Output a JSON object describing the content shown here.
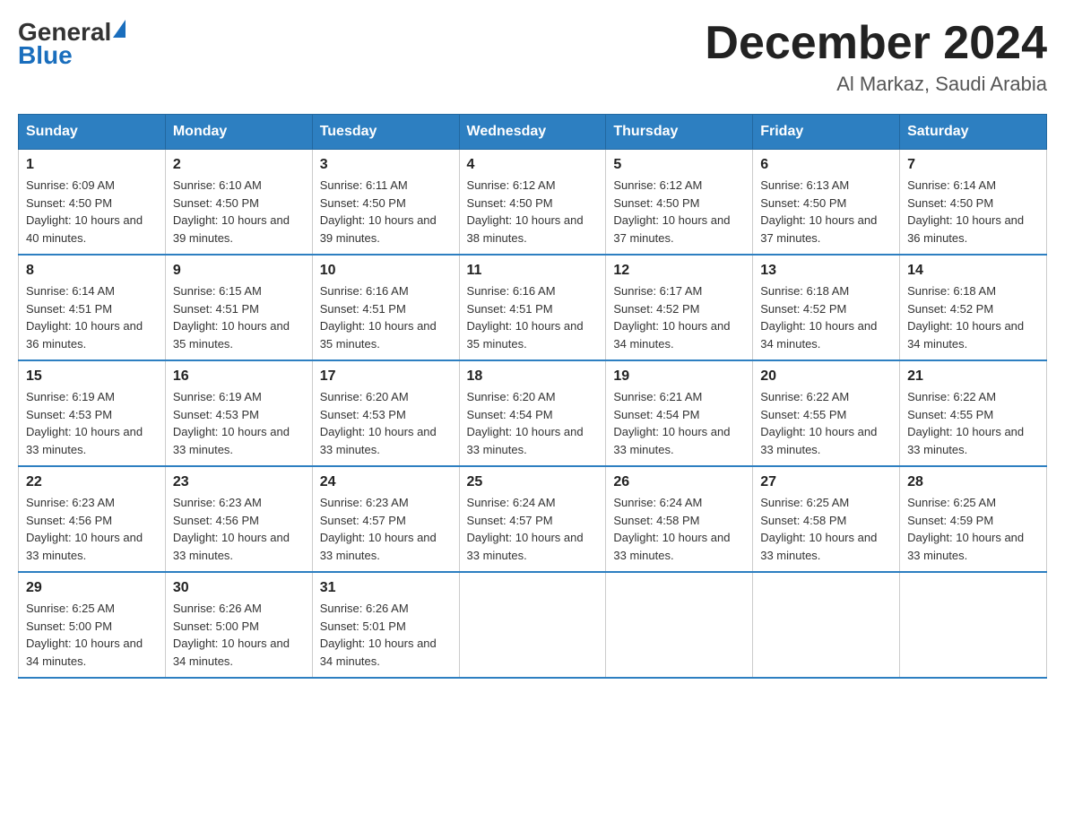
{
  "header": {
    "logo_general": "General",
    "logo_blue": "Blue",
    "month_year": "December 2024",
    "location": "Al Markaz, Saudi Arabia"
  },
  "days_of_week": [
    "Sunday",
    "Monday",
    "Tuesday",
    "Wednesday",
    "Thursday",
    "Friday",
    "Saturday"
  ],
  "weeks": [
    [
      {
        "day": "1",
        "sunrise": "6:09 AM",
        "sunset": "4:50 PM",
        "daylight": "10 hours and 40 minutes."
      },
      {
        "day": "2",
        "sunrise": "6:10 AM",
        "sunset": "4:50 PM",
        "daylight": "10 hours and 39 minutes."
      },
      {
        "day": "3",
        "sunrise": "6:11 AM",
        "sunset": "4:50 PM",
        "daylight": "10 hours and 39 minutes."
      },
      {
        "day": "4",
        "sunrise": "6:12 AM",
        "sunset": "4:50 PM",
        "daylight": "10 hours and 38 minutes."
      },
      {
        "day": "5",
        "sunrise": "6:12 AM",
        "sunset": "4:50 PM",
        "daylight": "10 hours and 37 minutes."
      },
      {
        "day": "6",
        "sunrise": "6:13 AM",
        "sunset": "4:50 PM",
        "daylight": "10 hours and 37 minutes."
      },
      {
        "day": "7",
        "sunrise": "6:14 AM",
        "sunset": "4:50 PM",
        "daylight": "10 hours and 36 minutes."
      }
    ],
    [
      {
        "day": "8",
        "sunrise": "6:14 AM",
        "sunset": "4:51 PM",
        "daylight": "10 hours and 36 minutes."
      },
      {
        "day": "9",
        "sunrise": "6:15 AM",
        "sunset": "4:51 PM",
        "daylight": "10 hours and 35 minutes."
      },
      {
        "day": "10",
        "sunrise": "6:16 AM",
        "sunset": "4:51 PM",
        "daylight": "10 hours and 35 minutes."
      },
      {
        "day": "11",
        "sunrise": "6:16 AM",
        "sunset": "4:51 PM",
        "daylight": "10 hours and 35 minutes."
      },
      {
        "day": "12",
        "sunrise": "6:17 AM",
        "sunset": "4:52 PM",
        "daylight": "10 hours and 34 minutes."
      },
      {
        "day": "13",
        "sunrise": "6:18 AM",
        "sunset": "4:52 PM",
        "daylight": "10 hours and 34 minutes."
      },
      {
        "day": "14",
        "sunrise": "6:18 AM",
        "sunset": "4:52 PM",
        "daylight": "10 hours and 34 minutes."
      }
    ],
    [
      {
        "day": "15",
        "sunrise": "6:19 AM",
        "sunset": "4:53 PM",
        "daylight": "10 hours and 33 minutes."
      },
      {
        "day": "16",
        "sunrise": "6:19 AM",
        "sunset": "4:53 PM",
        "daylight": "10 hours and 33 minutes."
      },
      {
        "day": "17",
        "sunrise": "6:20 AM",
        "sunset": "4:53 PM",
        "daylight": "10 hours and 33 minutes."
      },
      {
        "day": "18",
        "sunrise": "6:20 AM",
        "sunset": "4:54 PM",
        "daylight": "10 hours and 33 minutes."
      },
      {
        "day": "19",
        "sunrise": "6:21 AM",
        "sunset": "4:54 PM",
        "daylight": "10 hours and 33 minutes."
      },
      {
        "day": "20",
        "sunrise": "6:22 AM",
        "sunset": "4:55 PM",
        "daylight": "10 hours and 33 minutes."
      },
      {
        "day": "21",
        "sunrise": "6:22 AM",
        "sunset": "4:55 PM",
        "daylight": "10 hours and 33 minutes."
      }
    ],
    [
      {
        "day": "22",
        "sunrise": "6:23 AM",
        "sunset": "4:56 PM",
        "daylight": "10 hours and 33 minutes."
      },
      {
        "day": "23",
        "sunrise": "6:23 AM",
        "sunset": "4:56 PM",
        "daylight": "10 hours and 33 minutes."
      },
      {
        "day": "24",
        "sunrise": "6:23 AM",
        "sunset": "4:57 PM",
        "daylight": "10 hours and 33 minutes."
      },
      {
        "day": "25",
        "sunrise": "6:24 AM",
        "sunset": "4:57 PM",
        "daylight": "10 hours and 33 minutes."
      },
      {
        "day": "26",
        "sunrise": "6:24 AM",
        "sunset": "4:58 PM",
        "daylight": "10 hours and 33 minutes."
      },
      {
        "day": "27",
        "sunrise": "6:25 AM",
        "sunset": "4:58 PM",
        "daylight": "10 hours and 33 minutes."
      },
      {
        "day": "28",
        "sunrise": "6:25 AM",
        "sunset": "4:59 PM",
        "daylight": "10 hours and 33 minutes."
      }
    ],
    [
      {
        "day": "29",
        "sunrise": "6:25 AM",
        "sunset": "5:00 PM",
        "daylight": "10 hours and 34 minutes."
      },
      {
        "day": "30",
        "sunrise": "6:26 AM",
        "sunset": "5:00 PM",
        "daylight": "10 hours and 34 minutes."
      },
      {
        "day": "31",
        "sunrise": "6:26 AM",
        "sunset": "5:01 PM",
        "daylight": "10 hours and 34 minutes."
      },
      null,
      null,
      null,
      null
    ]
  ],
  "labels": {
    "sunrise_prefix": "Sunrise: ",
    "sunset_prefix": "Sunset: ",
    "daylight_prefix": "Daylight: "
  }
}
